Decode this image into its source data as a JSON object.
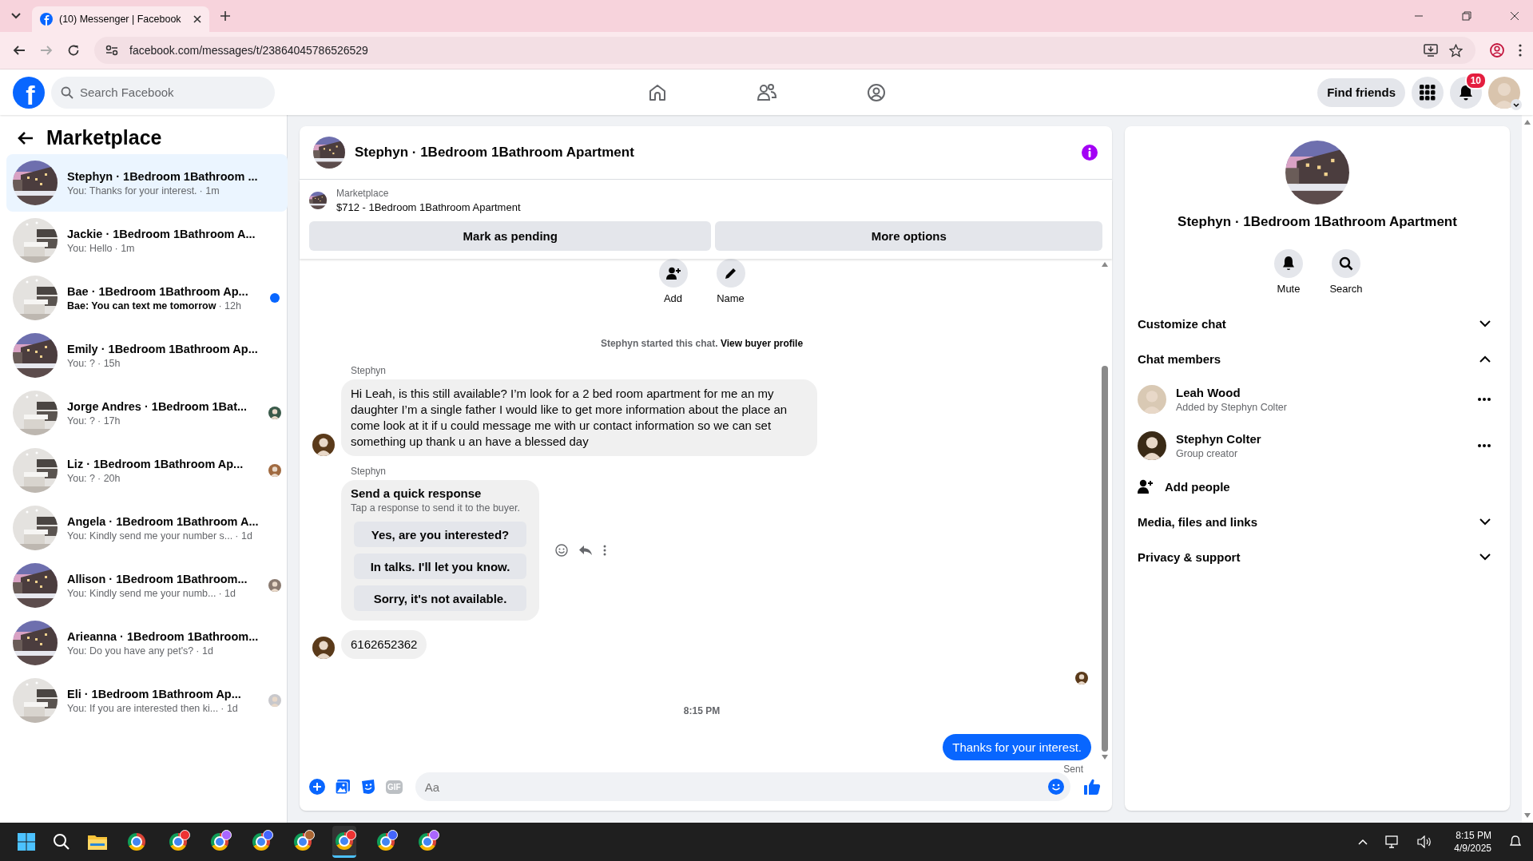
{
  "browser": {
    "tabs": [
      {
        "title": "(10) Messenger | Facebook",
        "selected": true
      }
    ],
    "url": "facebook.com/messages/t/23864045786526529"
  },
  "header": {
    "logo": "f",
    "search_placeholder": "Search Facebook",
    "find_friends": "Find friends",
    "notification_count": "10"
  },
  "sidebar": {
    "title": "Marketplace",
    "conversations": [
      {
        "name": "Stephyn · 1Bedroom 1Bathroom ...",
        "preview": "You: Thanks for your interest.",
        "time": "· 1m",
        "selected": true,
        "unread": false,
        "seen": false
      },
      {
        "name": "Jackie · 1Bedroom 1Bathroom A...",
        "preview": "You: Hello",
        "time": "· 1m",
        "selected": false,
        "unread": false,
        "seen": false
      },
      {
        "name": "Bae · 1Bedroom 1Bathroom Ap...",
        "preview": "Bae: You can text me tomorrow",
        "time": "· 12h",
        "selected": false,
        "unread": true,
        "seen": false
      },
      {
        "name": "Emily · 1Bedroom 1Bathroom Ap...",
        "preview": "You: ?",
        "time": "· 15h",
        "selected": false,
        "unread": false,
        "seen": false
      },
      {
        "name": "Jorge Andres · 1Bedroom 1Bat...",
        "preview": "You: ?",
        "time": "· 17h",
        "selected": false,
        "unread": false,
        "seen": true
      },
      {
        "name": "Liz · 1Bedroom 1Bathroom Ap...",
        "preview": "You: ?",
        "time": "· 20h",
        "selected": false,
        "unread": false,
        "seen": true
      },
      {
        "name": "Angela · 1Bedroom 1Bathroom A...",
        "preview": "You: Kindly send me your number s...",
        "time": "· 1d",
        "selected": false,
        "unread": false,
        "seen": false
      },
      {
        "name": "Allison · 1Bedroom 1Bathroom...",
        "preview": "You: Kindly send me your numb...",
        "time": "· 1d",
        "selected": false,
        "unread": false,
        "seen": true
      },
      {
        "name": "Arieanna · 1Bedroom 1Bathroom...",
        "preview": "You: Do you have any pet's?",
        "time": "· 1d",
        "selected": false,
        "unread": false,
        "seen": false
      },
      {
        "name": "Eli · 1Bedroom 1Bathroom Ap...",
        "preview": "You: If you are interested then ki...",
        "time": "· 1d",
        "selected": false,
        "unread": false,
        "seen": true
      }
    ]
  },
  "chat": {
    "title": "Stephyn · 1Bedroom 1Bathroom Apartment",
    "listing_label": "Marketplace",
    "listing": "$712 - 1Bedroom 1Bathroom Apartment",
    "buttons": [
      "Mark as pending",
      "More options"
    ],
    "actions": [
      {
        "kind": "add",
        "label": "Add"
      },
      {
        "kind": "name",
        "label": "Name"
      }
    ],
    "system": {
      "text": "Stephyn started this chat.",
      "link": "View buyer profile"
    },
    "messages": [
      {
        "kind": "incoming",
        "sender": "Stephyn",
        "text": "Hi Leah, is this still available? I’m look for a 2 bed  room apartment for me an my daughter I’m a single father I would like to get more information about the place an come look at it if u could message me with ur contact information so we can set something up thank u an have a blessed day"
      },
      {
        "kind": "quick_response",
        "sender": "Stephyn",
        "title": "Send a quick response",
        "subtitle": "Tap a response to send it to the buyer.",
        "options": [
          "Yes, are you interested?",
          "In talks. I'll let you know.",
          "Sorry, it's not available."
        ]
      },
      {
        "kind": "incoming",
        "text": "6162652362"
      },
      {
        "kind": "seen"
      },
      {
        "kind": "timestamp",
        "text": "8:15 PM"
      },
      {
        "kind": "outgoing",
        "text": "Thanks for your interest.",
        "status": "Sent"
      }
    ],
    "composer": {
      "gif": "GIF",
      "placeholder": "Aa"
    }
  },
  "details": {
    "title": "Stephyn · 1Bedroom 1Bathroom Apartment",
    "actions": [
      {
        "kind": "mute",
        "label": "Mute"
      },
      {
        "kind": "search",
        "label": "Search"
      }
    ],
    "sections": [
      {
        "label": "Customize chat",
        "expanded": false
      },
      {
        "label": "Chat members",
        "expanded": true,
        "members": [
          {
            "name": "Leah Wood",
            "role": "Added by Stephyn Colter"
          },
          {
            "name": "Stephyn Colter",
            "role": "Group creator"
          }
        ],
        "add": "Add people"
      },
      {
        "label": "Media, files and links",
        "expanded": false
      },
      {
        "label": "Privacy & support",
        "expanded": false
      }
    ]
  },
  "taskbar": {
    "time": "8:15 PM",
    "date": "4/9/2025"
  }
}
